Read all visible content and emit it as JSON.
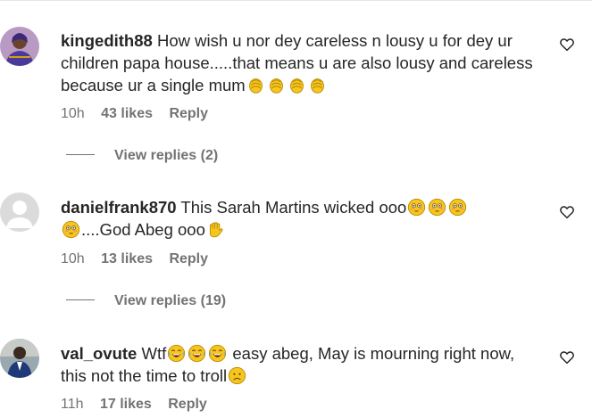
{
  "colors": {
    "text": "#262626",
    "secondary": "#737373",
    "emoji_yellow": "#f7c520"
  },
  "comments": [
    {
      "username": "kingedith88",
      "text_line1": "How wish u nor dey careless n lousy u for dey ur",
      "text_line2": "children papa house.....that means u are also lousy and careless",
      "text_line3": "because ur a single mum",
      "emoji_trailing": "clapping-hands-emoji",
      "time": "10h",
      "likes": "43 likes",
      "reply": "Reply",
      "view_replies": "View replies (2)",
      "avatar": "user-photo-avatar"
    },
    {
      "username": "danielfrank870",
      "text_part1": "This Sarah Martins wicked ooo",
      "text_part2": "....God Abeg ooo",
      "emoji_a": "flushed-face-emoji",
      "emoji_b": "raised-hand-emoji",
      "time": "10h",
      "likes": "13 likes",
      "reply": "Reply",
      "view_replies": "View replies (19)",
      "avatar": "default-avatar"
    },
    {
      "username": "val_ovute",
      "text_part1": "Wtf",
      "text_part2": "easy abeg, May is mourning right now,",
      "text_line2": "this not the time to troll",
      "emoji_a": "tears-of-joy-emoji",
      "emoji_b": "sad-face-emoji",
      "time": "11h",
      "likes": "17 likes",
      "reply": "Reply",
      "avatar": "user-photo-avatar"
    }
  ]
}
